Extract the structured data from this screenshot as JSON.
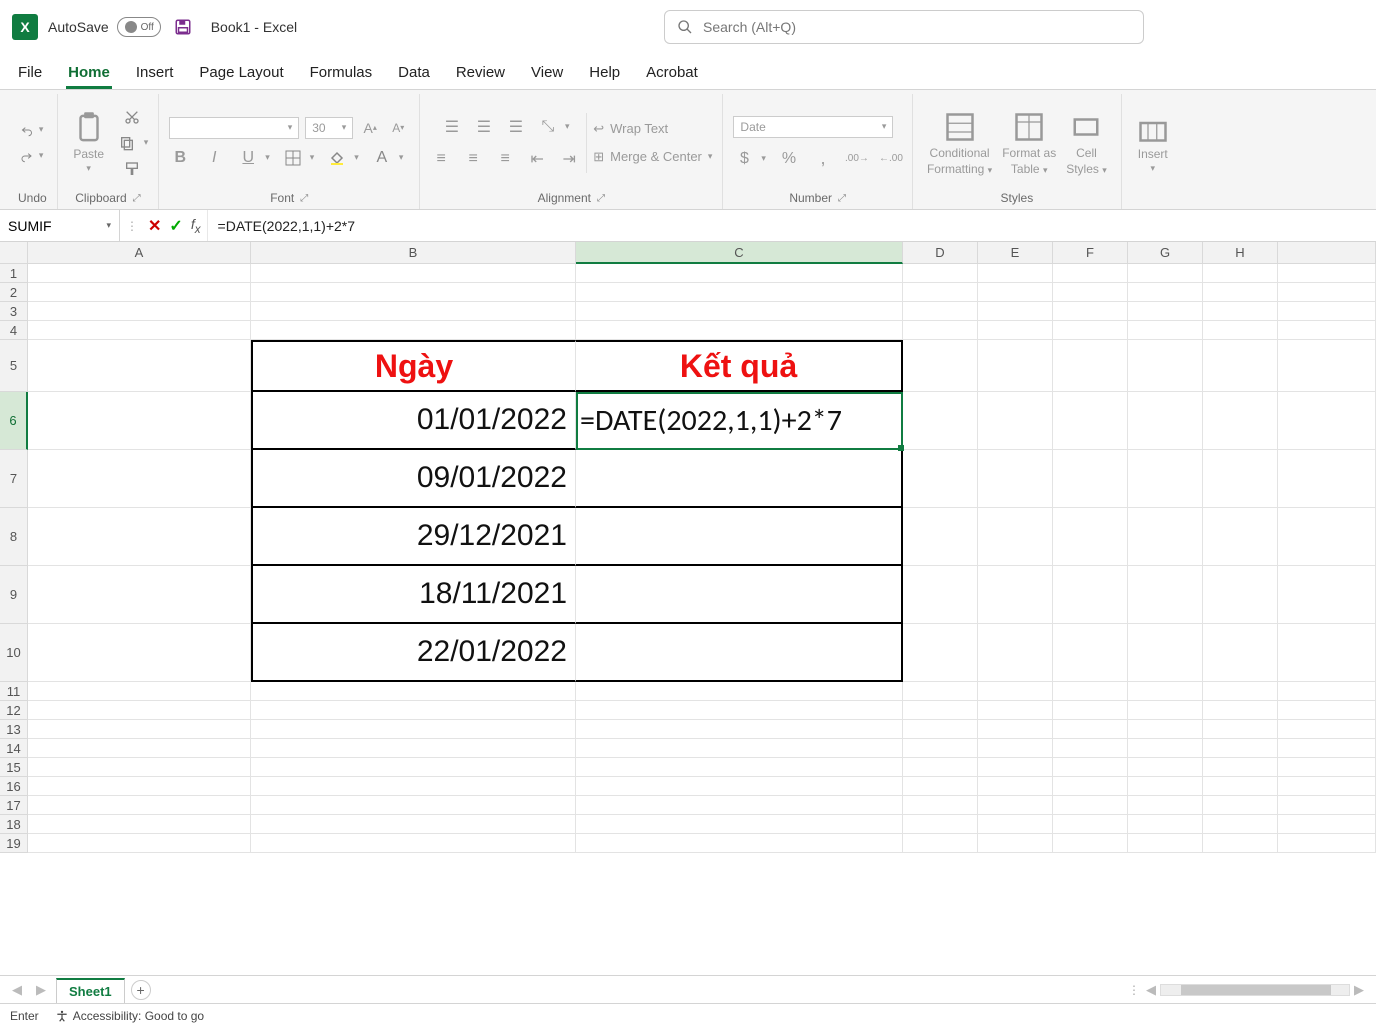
{
  "title": {
    "autosave_label": "AutoSave",
    "autosave_state": "Off",
    "doc_name": "Book1  -  Excel"
  },
  "search": {
    "placeholder": "Search (Alt+Q)"
  },
  "tabs": [
    "File",
    "Home",
    "Insert",
    "Page Layout",
    "Formulas",
    "Data",
    "Review",
    "View",
    "Help",
    "Acrobat"
  ],
  "active_tab": "Home",
  "ribbon": {
    "undo": {
      "label": "Undo"
    },
    "clipboard": {
      "paste": "Paste",
      "label": "Clipboard"
    },
    "font": {
      "name_placeholder": "",
      "size": "30",
      "label": "Font"
    },
    "alignment": {
      "wrap": "Wrap Text",
      "merge": "Merge & Center",
      "label": "Alignment"
    },
    "number": {
      "format": "Date",
      "label": "Number"
    },
    "styles": {
      "cond": "Conditional Formatting",
      "cond1": "Conditional",
      "cond2": "Formatting",
      "table1": "Format as",
      "table2": "Table",
      "cell1": "Cell",
      "cell2": "Styles",
      "label": "Styles"
    },
    "cells_insert": "Insert"
  },
  "formula_bar": {
    "namebox": "SUMIF",
    "formula": "=DATE(2022,1,1)+2*7"
  },
  "columns": [
    "A",
    "B",
    "C",
    "D",
    "E",
    "F",
    "G",
    "H"
  ],
  "rows": [
    "1",
    "2",
    "3",
    "4",
    "5",
    "6",
    "7",
    "8",
    "9",
    "10",
    "11",
    "12",
    "13",
    "14",
    "15",
    "16",
    "17",
    "18",
    "19"
  ],
  "active_cell": {
    "col": "C",
    "row": "6"
  },
  "table": {
    "header": {
      "b": "Ngày",
      "c": "Kết quả"
    },
    "c6_display": "=DATE(2022,1,1)+2*7",
    "b": [
      "01/01/2022",
      "09/01/2022",
      "29/12/2021",
      "18/11/2021",
      "22/01/2022"
    ]
  },
  "sheets": {
    "active": "Sheet1"
  },
  "status": {
    "mode": "Enter",
    "accessibility": "Accessibility: Good to go"
  }
}
